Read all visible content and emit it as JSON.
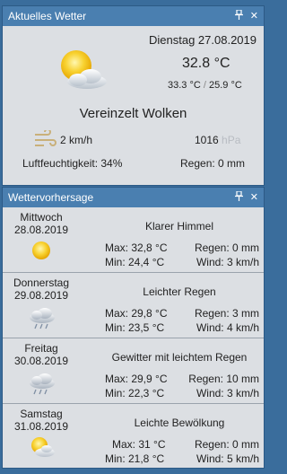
{
  "current": {
    "title": "Aktuelles Wetter",
    "date": "Dienstag 27.08.2019",
    "temp": "32.8 °C",
    "temp_high": "33.3 °C",
    "temp_sep": "/",
    "temp_low": "25.9 °C",
    "condition": "Vereinzelt Wolken",
    "wind": "2 km/h",
    "pressure_value": "1016",
    "pressure_unit": "hPa",
    "humidity": "Luftfeuchtigkeit: 34%",
    "rain": "Regen: 0 mm"
  },
  "forecast": {
    "title": "Wettervorhersage",
    "days": [
      {
        "day": "Mittwoch",
        "date": "28.08.2019",
        "condition": "Klarer Himmel",
        "max": "Max: 32,8 °C",
        "min": "Min: 24,4 °C",
        "rain": "Regen: 0 mm",
        "wind": "Wind: 3 km/h",
        "icon": "sun-icon"
      },
      {
        "day": "Donnerstag",
        "date": "29.08.2019",
        "condition": "Leichter Regen",
        "max": "Max: 29,8 °C",
        "min": "Min: 23,5 °C",
        "rain": "Regen: 3 mm",
        "wind": "Wind: 4 km/h",
        "icon": "rain-cloud-icon"
      },
      {
        "day": "Freitag",
        "date": "30.08.2019",
        "condition": "Gewitter mit leichtem Regen",
        "max": "Max: 29,9 °C",
        "min": "Min: 22,3 °C",
        "rain": "Regen: 10 mm",
        "wind": "Wind: 3 km/h",
        "icon": "thunderstorm-icon"
      },
      {
        "day": "Samstag",
        "date": "31.08.2019",
        "condition": "Leichte Bewölkung",
        "max": "Max: 31 °C",
        "min": "Min: 21,8 °C",
        "rain": "Regen: 0 mm",
        "wind": "Wind: 5 km/h",
        "icon": "sun-cloud-icon"
      }
    ]
  },
  "icons": {
    "pin": "pin-icon",
    "close": "close-icon",
    "wind": "wind-icon"
  },
  "colors": {
    "title_bar": "#4a7fb0",
    "panel_bg": "#dcdfe3",
    "window_bg": "#3a6d9c",
    "sun": "#f5c518"
  }
}
